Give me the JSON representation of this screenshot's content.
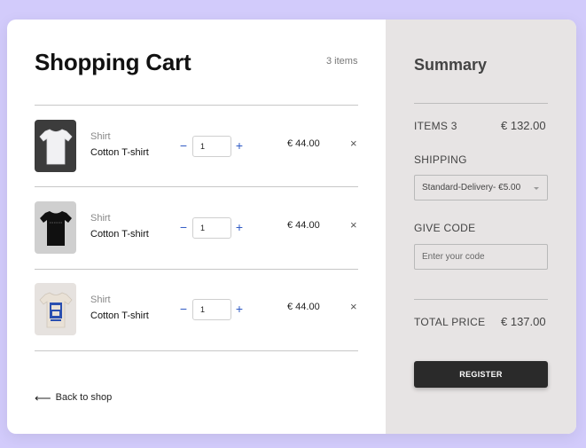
{
  "cart": {
    "title": "Shopping Cart",
    "count_label": "3 items",
    "items": [
      {
        "category": "Shirt",
        "name": "Cotton T-shirt",
        "quantity": "1",
        "price": "€ 44.00",
        "remove": "×",
        "shirt_color": "#f1f1f3",
        "thumb_bg": "#3c3c3c",
        "image": "white-tshirt"
      },
      {
        "category": "Shirt",
        "name": "Cotton T-shirt",
        "quantity": "1",
        "price": "€ 44.00",
        "remove": "×",
        "shirt_color": "#101010",
        "thumb_bg": "#cfcfcf",
        "image": "black-tshirt"
      },
      {
        "category": "Shirt",
        "name": "Cotton T-shirt",
        "quantity": "1",
        "price": "€ 44.00",
        "remove": "×",
        "shirt_color": "#e9e1d6",
        "thumb_bg": "#e6e2df",
        "image": "printed-tshirt"
      }
    ],
    "minus": "−",
    "plus": "+",
    "back_arrow": "⟵",
    "back_label": "Back to shop"
  },
  "summary": {
    "title": "Summary",
    "items_label": "ITEMS 3",
    "items_value": "€ 132.00",
    "shipping_label": "SHIPPING",
    "shipping_selected": "Standard-Delivery- €5.00",
    "code_label": "GIVE CODE",
    "code_placeholder": "Enter your code",
    "total_label": "TOTAL PRICE",
    "total_value": "€ 137.00",
    "register_label": "REGISTER"
  },
  "colors": {
    "background": "#d2cbfb",
    "summary_panel": "#e7e4e4",
    "accent_blue": "#2e59c4",
    "button_dark": "#2a2a2a"
  }
}
